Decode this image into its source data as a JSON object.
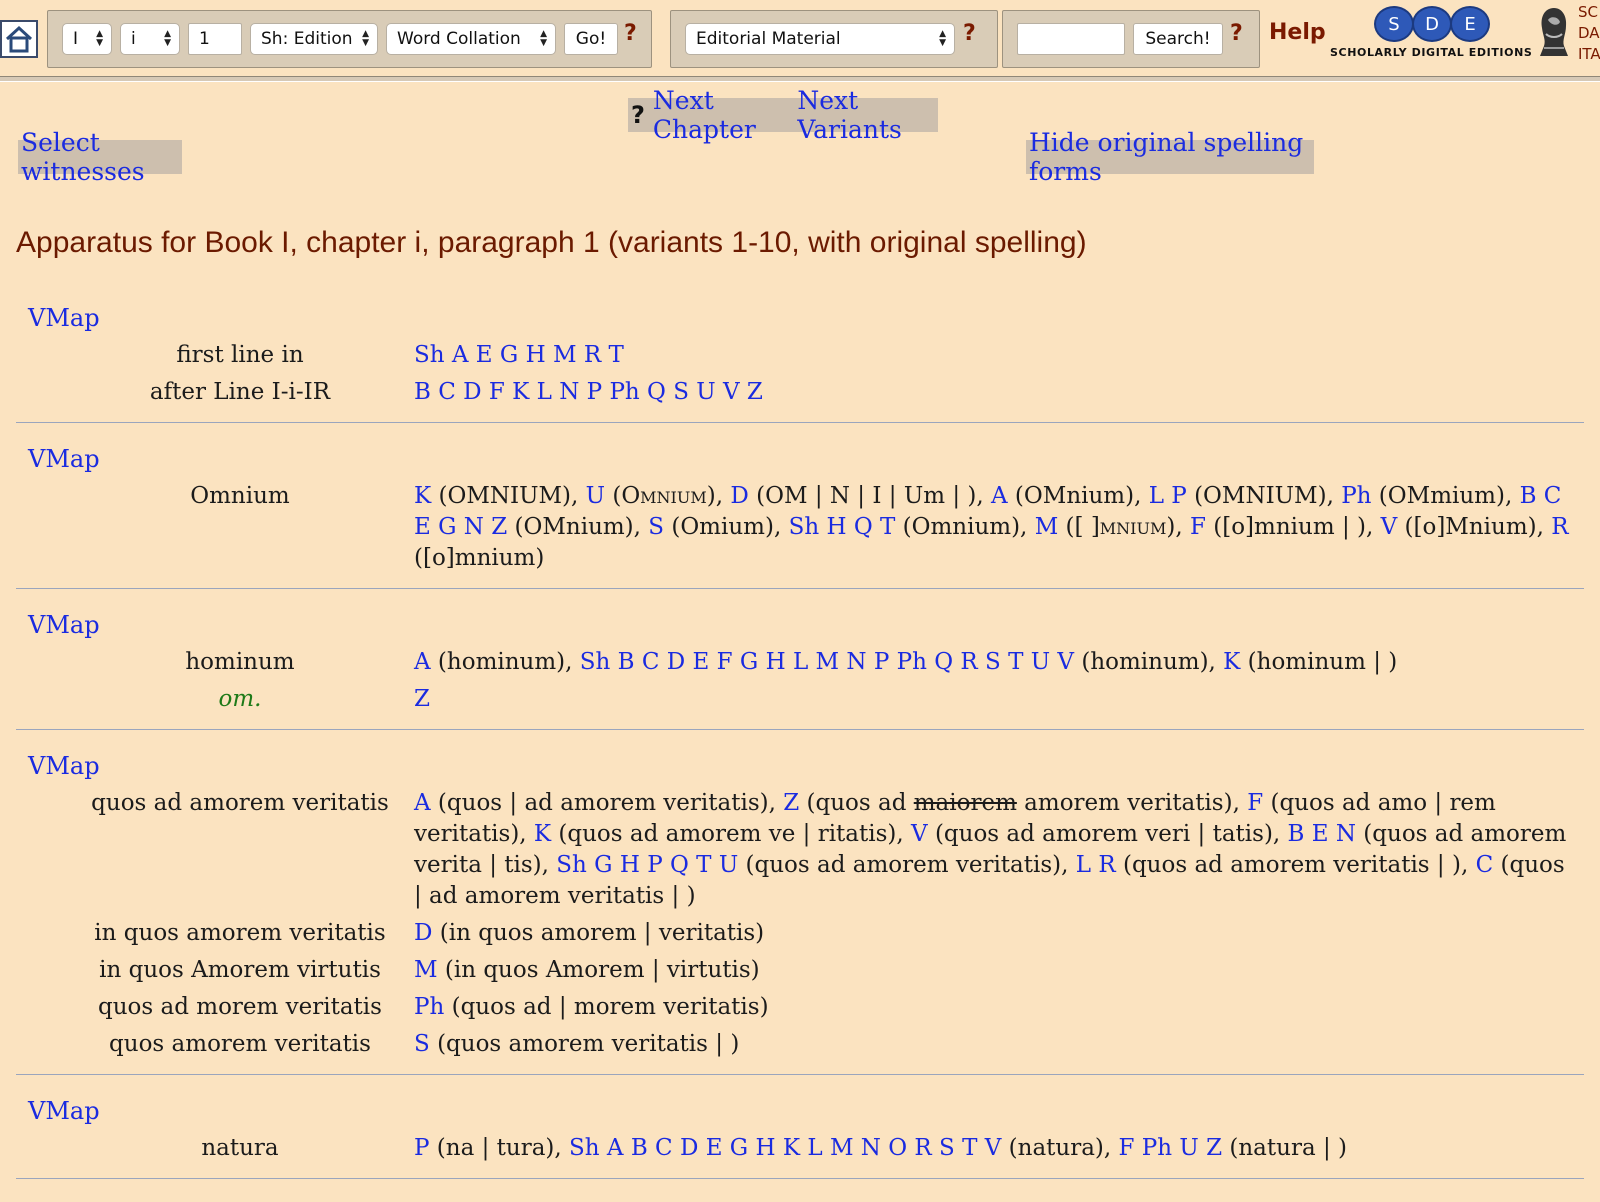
{
  "toolbar": {
    "book": "I",
    "chapter": "i",
    "paragraph": "1",
    "edition": "Sh: Edition",
    "view": "Word Collation",
    "go": "Go!",
    "editorial": "Editorial Material",
    "search_value": "",
    "search": "Search!",
    "help_q": "?",
    "help": "Help",
    "logo_letters": [
      "S",
      "D",
      "E"
    ],
    "logo_tagline": "SCHOLARLY DIGITAL EDITIONS",
    "edge_text": [
      "SC",
      "DA",
      "ITA"
    ]
  },
  "nav": {
    "help_q": "?",
    "next_chapter": "Next Chapter",
    "next_variants": "Next Variants",
    "select_witnesses": "Select witnesses",
    "hide_spelling": "Hide original spelling forms"
  },
  "title": "Apparatus for Book I, chapter i, paragraph 1 (variants 1-10, with original spelling)",
  "apparatus": [
    {
      "vmap": "VMap",
      "rows": [
        {
          "lemma": "first line in",
          "readings": [
            {
              "sigla": "Sh A E G H M R T"
            }
          ]
        },
        {
          "lemma": "after Line I-i-IR",
          "readings": [
            {
              "sigla": "B C D F K L N P Ph Q S U V Z"
            }
          ]
        }
      ]
    },
    {
      "vmap": "VMap",
      "rows": [
        {
          "lemma": "Omnium",
          "readings": [
            {
              "sigla": "K",
              "text": " (OMNIUM), "
            },
            {
              "sigla": "U",
              "text": " (",
              "sc": "Omnium",
              "after": "), "
            },
            {
              "sigla": "D",
              "text": " (OM | N | I | Um | ), "
            },
            {
              "sigla": "A",
              "text": " (OMnium), "
            },
            {
              "sigla": "L P",
              "text": " (OMNIUM), "
            },
            {
              "sigla": "Ph",
              "text": " (OMmium), "
            },
            {
              "sigla": "B C E G N Z",
              "text": " (OMnium), "
            },
            {
              "sigla": "S",
              "text": " (Omium), "
            },
            {
              "sigla": "Sh H Q T",
              "text": " (Omnium), "
            },
            {
              "sigla": "M",
              "text": " ([ ]",
              "sc": "mnium",
              "after": "), "
            },
            {
              "sigla": "F",
              "text": " ([o]mnium | ), "
            },
            {
              "sigla": "V",
              "text": " ([o]Mnium), "
            },
            {
              "sigla": "R",
              "text": " ([o]mnium)"
            }
          ]
        }
      ]
    },
    {
      "vmap": "VMap",
      "rows": [
        {
          "lemma": "hominum",
          "readings": [
            {
              "sigla": "A",
              "text": " (hominum), "
            },
            {
              "sigla": "Sh B C D E F G H L M N P Ph Q R S T U V",
              "text": " (hominum), "
            },
            {
              "sigla": "K",
              "text": " (hominum | )"
            }
          ]
        },
        {
          "lemma": "om.",
          "om": true,
          "readings": [
            {
              "sigla": "Z"
            }
          ]
        }
      ]
    },
    {
      "vmap": "VMap",
      "rows": [
        {
          "lemma": "quos ad amorem veritatis",
          "readings": [
            {
              "sigla": "A",
              "text": " (quos | ad amorem veritatis), "
            },
            {
              "sigla": "Z",
              "text": " (quos ad ",
              "strike": "maiorem",
              "after": " amorem veritatis), "
            },
            {
              "sigla": "F",
              "text": " (quos ad amo | rem veritatis), "
            },
            {
              "sigla": "K",
              "text": " (quos ad amorem ve | ritatis), "
            },
            {
              "sigla": "V",
              "text": " (quos ad amorem veri | tatis), "
            },
            {
              "sigla": "B E N",
              "text": " (quos ad amorem verita | tis), "
            },
            {
              "sigla": "Sh G H P Q T U",
              "text": " (quos ad amorem veritatis), "
            },
            {
              "sigla": "L R",
              "text": " (quos ad amorem veritatis | ), "
            },
            {
              "sigla": "C",
              "text": " (quos | ad amorem veritatis | )"
            }
          ]
        },
        {
          "lemma": "in quos amorem veritatis",
          "readings": [
            {
              "sigla": "D",
              "text": " (in quos amorem | veritatis)"
            }
          ]
        },
        {
          "lemma": "in quos Amorem virtutis",
          "readings": [
            {
              "sigla": "M",
              "text": " (in quos Amorem | virtutis)"
            }
          ]
        },
        {
          "lemma": "quos ad morem veritatis",
          "readings": [
            {
              "sigla": "Ph",
              "text": " (quos ad | morem veritatis)"
            }
          ]
        },
        {
          "lemma": "quos amorem veritatis",
          "readings": [
            {
              "sigla": "S",
              "text": " (quos amorem veritatis | )"
            }
          ]
        }
      ]
    },
    {
      "vmap": "VMap",
      "rows": [
        {
          "lemma": "natura",
          "readings": [
            {
              "sigla": "P",
              "text": " (na | tura), "
            },
            {
              "sigla": "Sh A B C D E G H K L M N O R S T V",
              "text": " (natura), "
            },
            {
              "sigla": "F Ph U Z",
              "text": " (natura | )"
            }
          ]
        }
      ]
    }
  ]
}
